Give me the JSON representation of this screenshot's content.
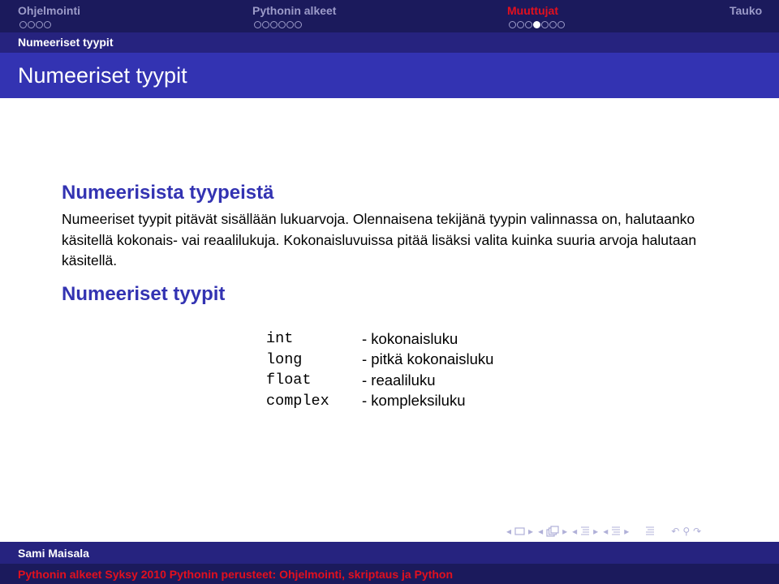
{
  "headline": {
    "sections": [
      {
        "label": "Ohjelmointi",
        "active": false,
        "dots": 4,
        "current_dot": -1
      },
      {
        "label": "Pythonin alkeet",
        "active": false,
        "dots": 6,
        "current_dot": -1
      },
      {
        "label": "Muuttujat",
        "active": true,
        "dots": 7,
        "current_dot": 3
      },
      {
        "label": "Tauko",
        "active": false,
        "dots": 0,
        "current_dot": -1
      }
    ]
  },
  "subsection": "Numeeriset tyypit",
  "frame_title": "Numeeriset tyypit",
  "content": {
    "block1_title": "Numeerisista tyypeistä",
    "block1_text": "Numeeriset tyypit pitävät sisällään lukuarvoja. Olennaisena tekijänä tyypin valinnassa on, halutaanko käsitellä kokonais- vai reaalilukuja. Kokonaisluvuissa pitää lisäksi valita kuinka suuria arvoja halutaan käsitellä.",
    "block2_title": "Numeeriset tyypit",
    "types": [
      {
        "name": "int",
        "desc": "- kokonaisluku"
      },
      {
        "name": "long",
        "desc": "- pitkä kokonaisluku"
      },
      {
        "name": "float",
        "desc": "- reaaliluku"
      },
      {
        "name": "complex",
        "desc": "- kompleksiluku"
      }
    ]
  },
  "nav_symbols": {
    "slide": "slide-nav",
    "frame": "frame-nav",
    "subsection": "subsection-nav",
    "section": "section-nav",
    "document": "document-nav",
    "search": "search"
  },
  "footer": {
    "author": "Sami Maisala",
    "title": "Pythonin alkeet Syksy 2010 Pythonin perusteet: Ohjelmointi, skriptaus ja Python"
  },
  "colors": {
    "headline_bg": "#1b1a5c",
    "subsection_bg": "#26237f",
    "frametitle_bg": "#3333b2",
    "active_section": "#e3101e",
    "inactive_section": "#9c9bc9"
  }
}
